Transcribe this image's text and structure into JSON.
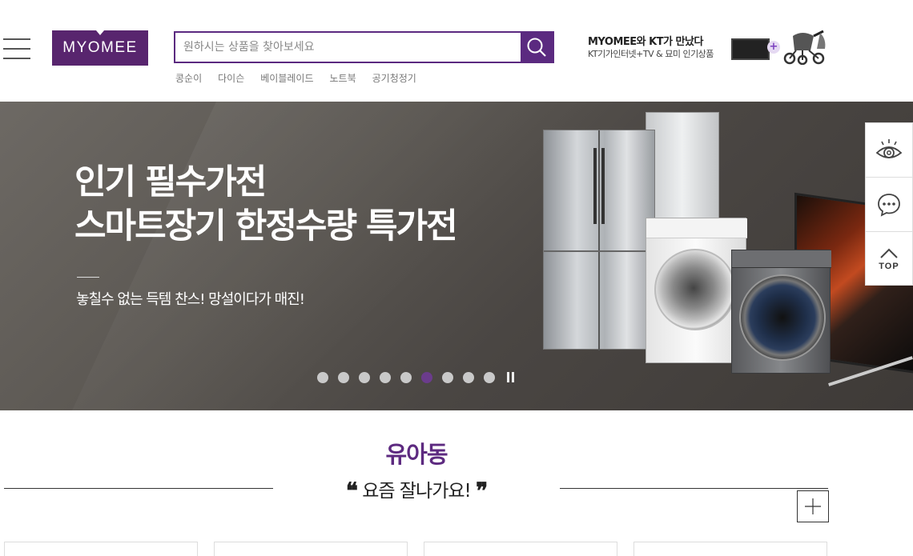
{
  "header": {
    "logo_text": "MYOMEE",
    "search_placeholder": "원하시는 상품을 찾아보세요",
    "keywords": [
      "콩순이",
      "다이슨",
      "베이블레이드",
      "노트북",
      "공기청정기"
    ],
    "promo": {
      "line1": "MYOMEE와 KT가 만났다",
      "line2": "KT기가인터넷+TV & 묘미 인기상품",
      "plus": "+"
    }
  },
  "banner": {
    "headline_line1": "인기 필수가전",
    "headline_line2": "스마트장기 한정수량 특가전",
    "subtext": "놓칠수 없는 득템 찬스! 망설이다가 매진!",
    "slide_count": 9,
    "active_slide": 6
  },
  "side_menu": {
    "top_label": "TOP"
  },
  "section": {
    "title": "유아동",
    "quote_open": "❝",
    "subtitle": "요즘 잘나가요!",
    "quote_close": "❞"
  },
  "colors": {
    "brand": "#5b2a80",
    "active_dot": "#6b3c8c"
  }
}
